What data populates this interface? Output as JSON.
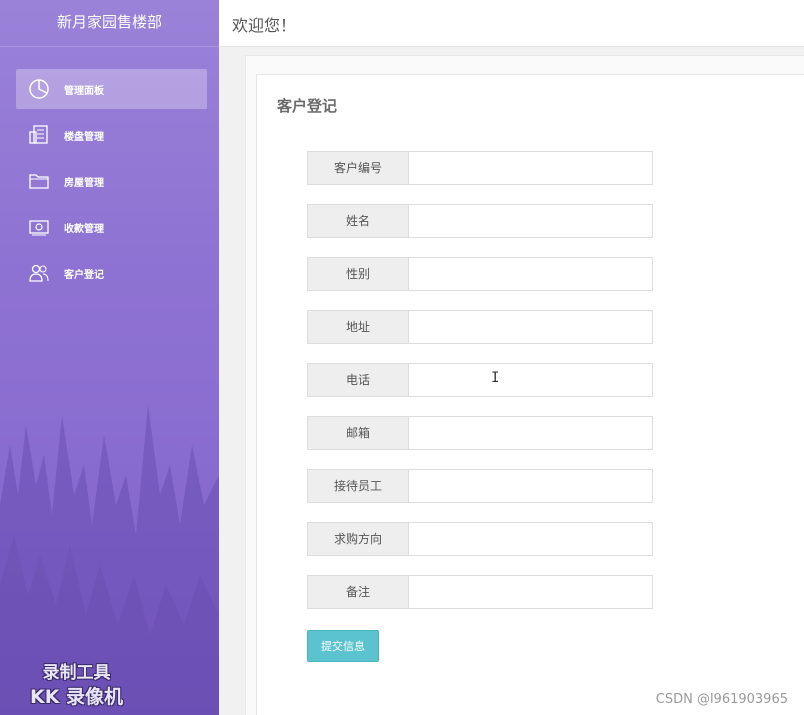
{
  "sidebar": {
    "brand": "新月家园售楼部",
    "items": [
      {
        "label": "管理面板",
        "icon": "pie-chart-icon",
        "active": true
      },
      {
        "label": "楼盘管理",
        "icon": "building-icon",
        "active": false
      },
      {
        "label": "房屋管理",
        "icon": "folder-icon",
        "active": false
      },
      {
        "label": "收款管理",
        "icon": "money-icon",
        "active": false
      },
      {
        "label": "客户登记",
        "icon": "users-icon",
        "active": false
      }
    ],
    "watermark": {
      "line1": "录制工具",
      "line2": "KK 录像机"
    }
  },
  "header": {
    "welcome": "欢迎您！"
  },
  "form": {
    "title": "客户登记",
    "fields": [
      {
        "label": "客户编号",
        "value": ""
      },
      {
        "label": "姓名",
        "value": ""
      },
      {
        "label": "性别",
        "value": ""
      },
      {
        "label": "地址",
        "value": ""
      },
      {
        "label": "电话",
        "value": ""
      },
      {
        "label": "邮箱",
        "value": ""
      },
      {
        "label": "接待员工",
        "value": ""
      },
      {
        "label": "求购方向",
        "value": ""
      },
      {
        "label": "备注",
        "value": ""
      }
    ],
    "submit_label": "提交信息"
  },
  "watermark": "CSDN @l961903965",
  "colors": {
    "sidebar": "#8f73d3",
    "submit": "#5bc3cf"
  }
}
